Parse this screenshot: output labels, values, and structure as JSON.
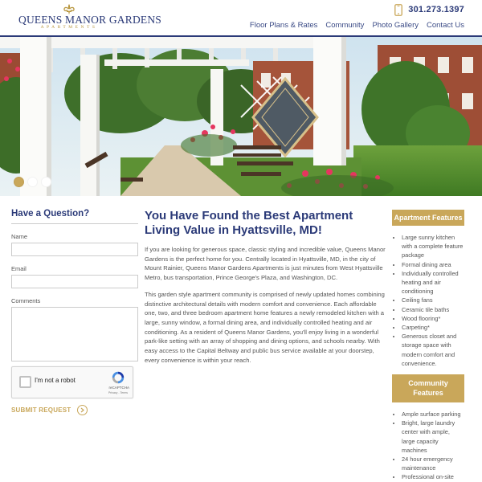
{
  "brand": {
    "name": "QUEENS MANOR GARDENS",
    "subtitle": "APARTMENTS",
    "phone": "301.273.1397",
    "colors": {
      "navy": "#2b3a78",
      "gold": "#c9a75a"
    }
  },
  "nav": {
    "items": [
      {
        "label": "Floor Plans & Rates"
      },
      {
        "label": "Community"
      },
      {
        "label": "Photo Gallery"
      },
      {
        "label": "Contact Us"
      }
    ]
  },
  "hero": {
    "slide_count": 3,
    "active_slide": 1
  },
  "form": {
    "title": "Have a Question?",
    "name_label": "Name",
    "email_label": "Email",
    "comments_label": "Comments",
    "captcha_label": "I'm not a robot",
    "captcha_brand": "reCAPTCHA",
    "captcha_terms": "Privacy - Terms",
    "submit_label": "SUBMIT REQUEST"
  },
  "main": {
    "title": "You Have Found the Best Apartment Living Value in Hyattsville, MD!",
    "paragraph1": "If you are looking for generous space, classic styling and incredible value, Queens Manor Gardens is the perfect home for you. Centrally located in Hyattsville, MD, in the city of Mount Rainier, Queens Manor Gardens Apartments is just minutes from West Hyattsville Metro, bus transportation, Prince George's Plaza, and Washington, DC.",
    "paragraph2": "This garden style apartment community is comprised of newly updated homes combining distinctive architectural details with modern comfort and convenience. Each affordable one, two, and three bedroom apartment home features a newly remodeled kitchen with a large, sunny window, a formal dining area, and individually controlled heating and air conditioning. As a resident of Queens Manor Gardens, you'll enjoy living in a wonderful park-like setting with an array of shopping and dining options, and schools nearby. With easy access to the Capital Beltway and public bus service available at your doorstep, every convenience is within your reach."
  },
  "apartment_features": {
    "title": "Apartment Features",
    "items": [
      "Large sunny kitchen with a complete feature package",
      "Formal dining area",
      "Individually controlled heating and air conditioning",
      "Ceiling fans",
      "Ceramic tile baths",
      "Wood flooring*",
      "Carpeting*",
      "Generous closet and storage space with modern comfort and convenience."
    ]
  },
  "community_features": {
    "title": "Community Features",
    "items": [
      "Ample surface parking",
      "Bright, large laundry center with ample, large capacity machines",
      "24 hour emergency maintenance",
      "Professional on-site"
    ]
  }
}
